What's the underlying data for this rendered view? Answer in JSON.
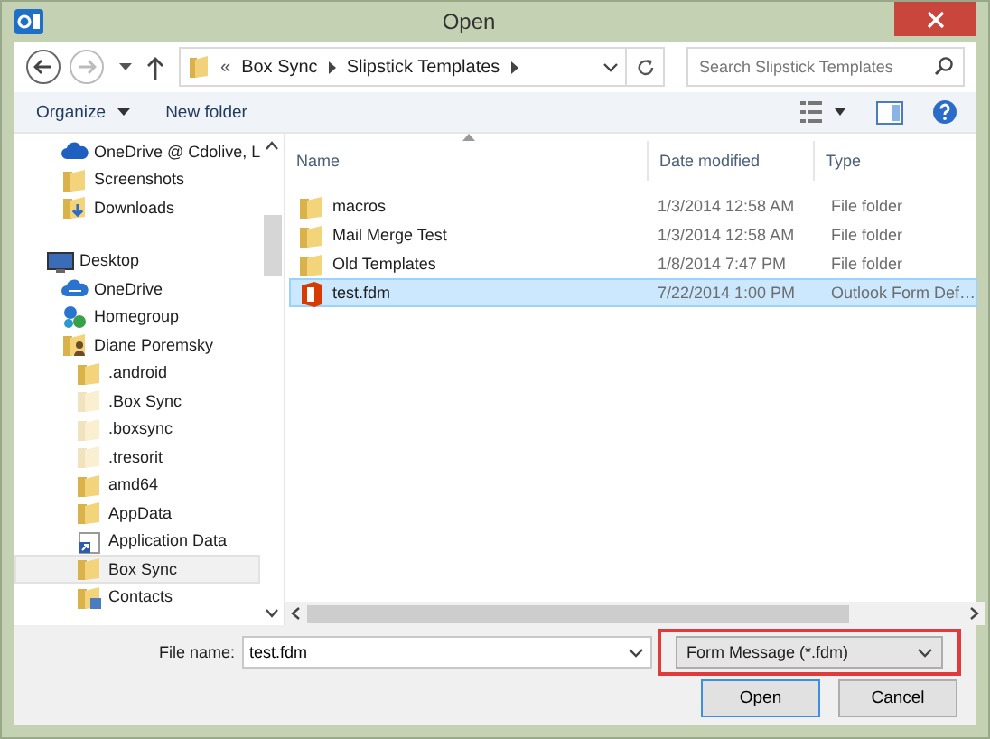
{
  "window": {
    "title": "Open"
  },
  "address": {
    "overflow": "«",
    "crumbs": [
      "Box Sync",
      "Slipstick Templates"
    ]
  },
  "search": {
    "placeholder": "Search Slipstick Templates"
  },
  "toolbar": {
    "organize": "Organize",
    "new_folder": "New folder"
  },
  "nav": {
    "favorites": [
      {
        "label": "OneDrive @ Cdolive, L",
        "kind": "cloud"
      },
      {
        "label": "Screenshots",
        "kind": "folder"
      },
      {
        "label": "Downloads",
        "kind": "download"
      }
    ],
    "tree": [
      {
        "label": "Desktop",
        "kind": "desktop",
        "selected": false,
        "hidden": false,
        "children": [
          {
            "label": "OneDrive",
            "kind": "cloud2",
            "selected": false,
            "hidden": false
          },
          {
            "label": "Homegroup",
            "kind": "homegroup",
            "selected": false,
            "hidden": false
          },
          {
            "label": "Diane Poremsky",
            "kind": "user",
            "selected": false,
            "hidden": false,
            "children": [
              {
                "label": ".android",
                "kind": "folder",
                "selected": false,
                "hidden": false
              },
              {
                "label": ".Box Sync",
                "kind": "folder",
                "selected": false,
                "hidden": true
              },
              {
                "label": ".boxsync",
                "kind": "folder",
                "selected": false,
                "hidden": true
              },
              {
                "label": ".tresorit",
                "kind": "folder",
                "selected": false,
                "hidden": true
              },
              {
                "label": "amd64",
                "kind": "folder",
                "selected": false,
                "hidden": false
              },
              {
                "label": "AppData",
                "kind": "folder",
                "selected": false,
                "hidden": false
              },
              {
                "label": "Application Data",
                "kind": "shortcut",
                "selected": false,
                "hidden": false
              },
              {
                "label": "Box Sync",
                "kind": "folder",
                "selected": true,
                "hidden": false
              },
              {
                "label": "Contacts",
                "kind": "contacts",
                "selected": false,
                "hidden": false
              }
            ]
          }
        ]
      }
    ]
  },
  "table": {
    "columns": [
      "Name",
      "Date modified",
      "Type"
    ],
    "rows": [
      {
        "name": "macros",
        "kind": "folder",
        "date": "1/3/2014 12:58 AM",
        "type": "File folder",
        "selected": false
      },
      {
        "name": "Mail Merge Test",
        "kind": "folder",
        "date": "1/3/2014 12:58 AM",
        "type": "File folder",
        "selected": false
      },
      {
        "name": "Old Templates",
        "kind": "folder",
        "date": "1/8/2014 7:47 PM",
        "type": "File folder",
        "selected": false
      },
      {
        "name": "test.fdm",
        "kind": "office",
        "date": "7/22/2014 1:00 PM",
        "type": "Outlook Form Def…",
        "selected": true
      }
    ]
  },
  "footer": {
    "file_name_label": "File name:",
    "file_name": "test.fdm",
    "file_type": "Form Message (*.fdm)",
    "buttons": [
      "Open",
      "Cancel"
    ]
  }
}
